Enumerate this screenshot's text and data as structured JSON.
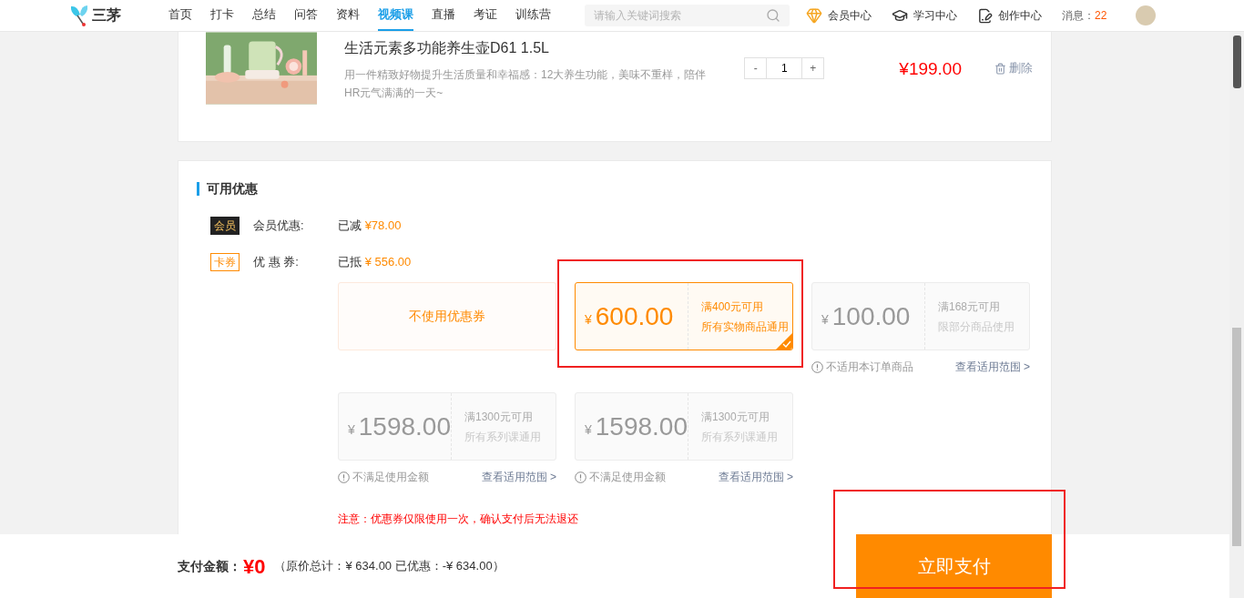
{
  "header": {
    "logo": "三茅",
    "nav": [
      {
        "label": "首页",
        "selected": false
      },
      {
        "label": "打卡",
        "selected": false
      },
      {
        "label": "总结",
        "selected": false
      },
      {
        "label": "问答",
        "selected": false
      },
      {
        "label": "资料",
        "selected": false
      },
      {
        "label": "视频课",
        "selected": true
      },
      {
        "label": "直播",
        "selected": false
      },
      {
        "label": "考证",
        "selected": false
      },
      {
        "label": "训练营",
        "selected": false
      }
    ],
    "search": {
      "placeholder": "请输入关键词搜索"
    },
    "links": [
      {
        "kind": "vip",
        "label": "会员中心"
      },
      {
        "kind": "study",
        "label": "学习中心"
      },
      {
        "kind": "create",
        "label": "创作中心"
      }
    ],
    "messages": {
      "label": "消息：",
      "count": "22"
    }
  },
  "product": {
    "title": "生活元素多功能养生壶D61 1.5L",
    "description": "用一件精致好物提升生活质量和幸福感：12大养生功能，美味不重样，陪伴HR元气满满的一天~",
    "quantity": "1",
    "minus": "-",
    "plus": "+",
    "price": "¥199.00",
    "delete": "删除"
  },
  "discounts": {
    "title": "可用优惠",
    "rows": [
      {
        "kind": "member",
        "tag": "会员",
        "label": "会员优惠:",
        "prefix": "已减",
        "amount": "¥78.00"
      },
      {
        "kind": "coupon",
        "tag": "卡券",
        "label": "优 惠 券:",
        "prefix": "已抵",
        "amount": "¥ 556.00"
      }
    ],
    "coupons": [
      {
        "kind": "none",
        "label": "不使用优惠券",
        "selected": false
      },
      {
        "kind": "coupon",
        "currency": "¥",
        "amount": "600.00",
        "condition": "满400元可用",
        "scope": "所有实物商品通用",
        "selected": true,
        "disabled": false
      },
      {
        "kind": "coupon",
        "currency": "¥",
        "amount": "100.00",
        "condition": "满168元可用",
        "scope": "限部分商品使用",
        "selected": false,
        "disabled": true,
        "note": "不适用本订单商品",
        "link": "查看适用范围 >"
      },
      {
        "kind": "coupon",
        "currency": "¥",
        "amount": "1598.00",
        "condition": "满1300元可用",
        "scope": "所有系列课通用",
        "selected": false,
        "disabled": true,
        "note": "不满足使用金额",
        "link": "查看适用范围 >"
      },
      {
        "kind": "coupon",
        "currency": "¥",
        "amount": "1598.00",
        "condition": "满1300元可用",
        "scope": "所有系列课通用",
        "selected": false,
        "disabled": true,
        "note": "不满足使用金额",
        "link": "查看适用范围 >"
      }
    ],
    "notice": "注意：优惠券仅限使用一次，确认支付后无法退还"
  },
  "footer": {
    "label": "支付金额：",
    "total": "¥0",
    "detail": "（原价总计：¥ 634.00 已优惠：-¥ 634.00）",
    "pay": "立即支付"
  }
}
